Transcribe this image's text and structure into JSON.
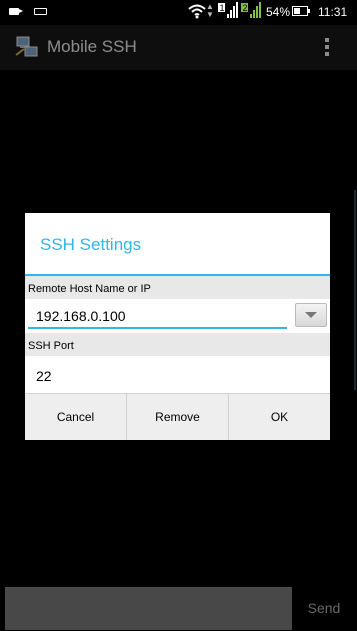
{
  "status_bar": {
    "sim1_label": "1",
    "sim2_label": "2",
    "battery_percent": "54%",
    "battery_level": 0.54,
    "time": "11:31",
    "icons": [
      "video-icon",
      "keyboard-icon",
      "wifi-icon",
      "data-arrows-icon",
      "sim1-signal-icon",
      "sim2-signal-icon",
      "battery-icon"
    ]
  },
  "action_bar": {
    "title": "Mobile SSH",
    "icon": "network-computer-icon",
    "overflow_icon": "overflow-menu-icon"
  },
  "dialog": {
    "title": "SSH Settings",
    "host_label": "Remote Host Name or IP",
    "host_value": "192.168.0.100",
    "port_label": "SSH Port",
    "port_value": "22",
    "buttons": {
      "cancel": "Cancel",
      "remove": "Remove",
      "ok": "OK"
    }
  },
  "bottom_bar": {
    "command_value": "",
    "send_label": "Send"
  },
  "colors": {
    "accent": "#33b5e5",
    "background": "#000000",
    "dialog_body": "#e8e8e8"
  }
}
